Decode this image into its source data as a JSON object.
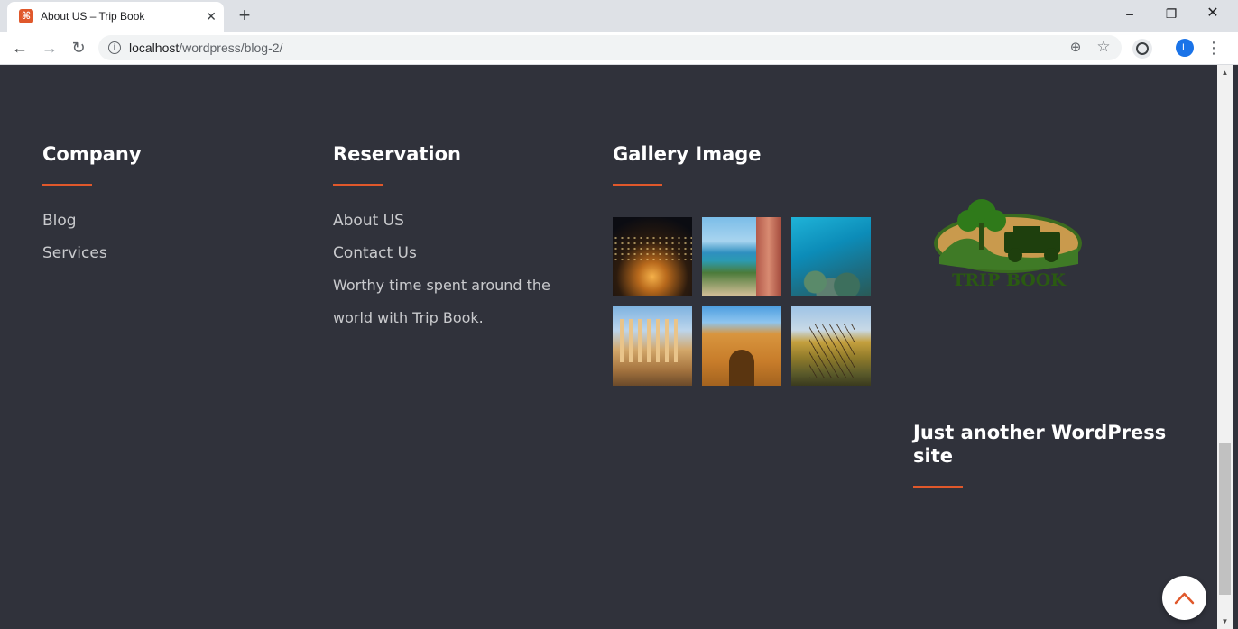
{
  "browser": {
    "tab_title": "About US – Trip Book",
    "tab_close_glyph": "✕",
    "new_tab_glyph": "+",
    "window_minimize_glyph": "–",
    "window_restore_glyph": "❐",
    "window_close_glyph": "✕",
    "url_host": "localhost",
    "url_path": "/wordpress/blog-2/",
    "profile_initial": "L",
    "back_glyph": "←",
    "forward_glyph": "→",
    "reload_glyph": "↻",
    "zoom_glyph": "⊕",
    "star_glyph": "☆",
    "menu_glyph": "⋮",
    "info_glyph": "i"
  },
  "footer": {
    "company": {
      "heading": "Company",
      "links": [
        "Blog",
        "Services"
      ]
    },
    "reservation": {
      "heading": "Reservation",
      "links": [
        "About US",
        "Contact Us"
      ],
      "description": "Worthy time spent around the world with Trip Book."
    },
    "gallery": {
      "heading": "Gallery Image",
      "images": [
        "night-city-amphitheatre",
        "red-sea-coast",
        "coral-reef",
        "ancient-colonnade",
        "stone-arch-gate",
        "autumn-trees"
      ]
    },
    "logo": {
      "text": "TRIP BOOK",
      "icon": "jeep-tree-logo"
    },
    "site": {
      "heading": "Just another WordPress site"
    }
  },
  "colors": {
    "background": "#30323b",
    "accent": "#e0582b",
    "heading": "#ffffff",
    "text": "#c9cacd"
  },
  "scroll_to_top": {
    "icon": "chevron-up-icon"
  }
}
